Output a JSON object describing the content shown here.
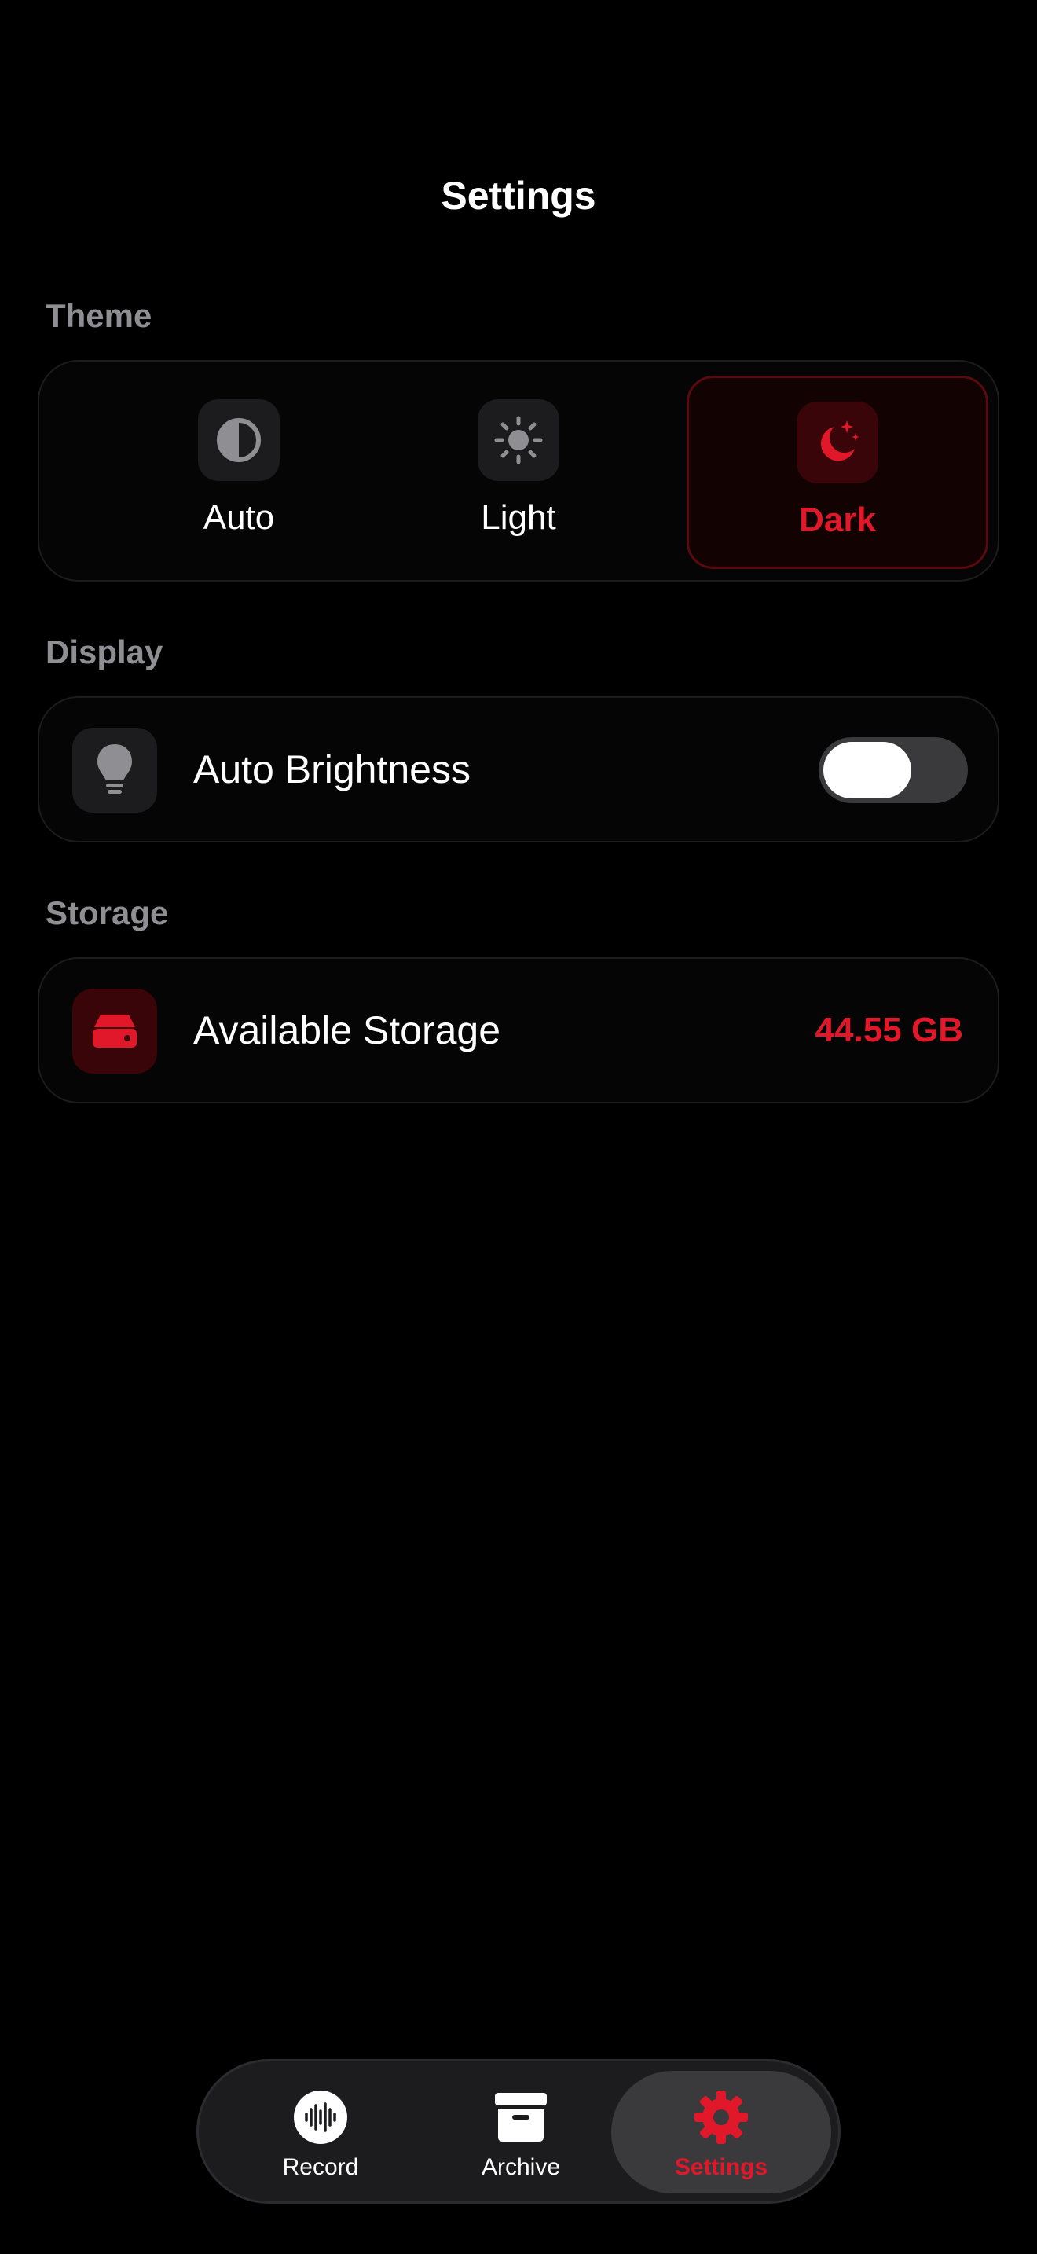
{
  "header": {
    "title": "Settings"
  },
  "sections": {
    "theme": {
      "label": "Theme",
      "options": [
        {
          "label": "Auto",
          "icon": "half-circle-icon",
          "selected": false
        },
        {
          "label": "Light",
          "icon": "sun-icon",
          "selected": false
        },
        {
          "label": "Dark",
          "icon": "moon-stars-icon",
          "selected": true
        }
      ]
    },
    "display": {
      "label": "Display",
      "auto_brightness": {
        "label": "Auto Brightness",
        "icon": "lightbulb-icon",
        "enabled": false
      }
    },
    "storage": {
      "label": "Storage",
      "available": {
        "label": "Available Storage",
        "icon": "drive-icon",
        "value": "44.55 GB"
      }
    }
  },
  "tab_bar": {
    "tabs": [
      {
        "label": "Record",
        "icon": "waveform-icon",
        "active": false
      },
      {
        "label": "Archive",
        "icon": "archive-box-icon",
        "active": false
      },
      {
        "label": "Settings",
        "icon": "gear-icon",
        "active": true
      }
    ]
  },
  "colors": {
    "accent": "#e0182a",
    "background": "#000000",
    "card": "#050505",
    "secondary_text": "#8e8e93"
  }
}
